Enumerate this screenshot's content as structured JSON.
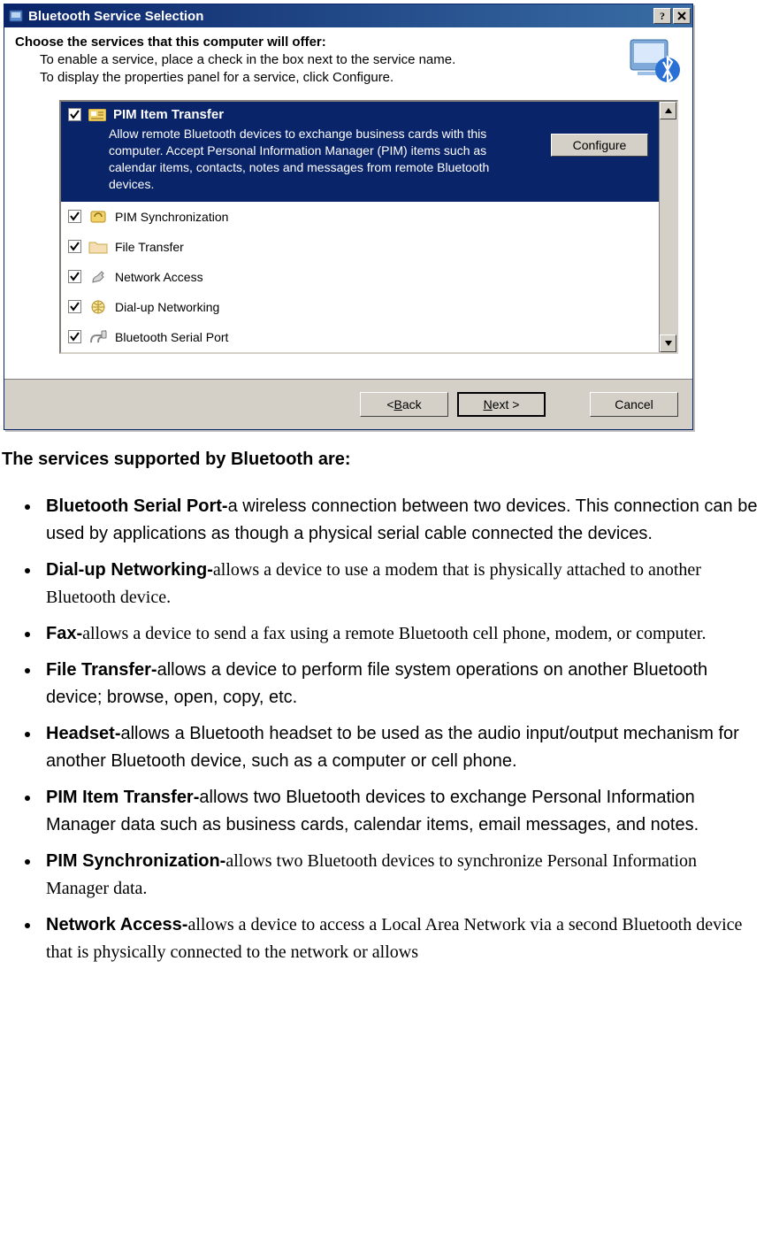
{
  "dialog": {
    "title": "Bluetooth Service Selection",
    "heading": "Choose the services that this computer will offer:",
    "sub1": "To enable a service, place a check in the box next to the service name.",
    "sub2": "To display the properties panel for a service, click Configure.",
    "configure": "Configure",
    "selected": {
      "name": "PIM Item Transfer",
      "desc": "Allow remote Bluetooth devices to exchange business cards with this computer. Accept Personal Information Manager (PIM) items such as calendar items, contacts, notes and messages from remote Bluetooth devices.",
      "checked": true
    },
    "services": [
      {
        "name": "PIM Synchronization",
        "checked": true,
        "icon": "sync"
      },
      {
        "name": "File Transfer",
        "checked": true,
        "icon": "folder"
      },
      {
        "name": "Network Access",
        "checked": true,
        "icon": "plug"
      },
      {
        "name": "Dial-up Networking",
        "checked": true,
        "icon": "globe"
      },
      {
        "name": "Bluetooth Serial Port",
        "checked": true,
        "icon": "serial"
      }
    ],
    "buttons": {
      "back_prefix": "< ",
      "back_letter": "B",
      "back_rest": "ack",
      "next_letter": "N",
      "next_rest": "ext >",
      "cancel": "Cancel"
    }
  },
  "doc": {
    "lead": "The services supported by Bluetooth are:",
    "items": [
      {
        "term": "Bluetooth Serial Port-",
        "body": "a wireless connection between two devices. This connection can be used by applications as though a physical serial cable connected the devices.",
        "alt": false
      },
      {
        "term": "Dial-up Networking-",
        "body": "allows a device to use a modem that is physically attached to another Bluetooth device.",
        "alt": true
      },
      {
        "term": "Fax-",
        "body": "allows a device to send a fax using a remote Bluetooth cell phone, modem, or computer.",
        "alt": true
      },
      {
        "term": "File Transfer-",
        "body": "allows a device to perform file system operations on another Bluetooth device; browse, open, copy, etc.",
        "alt": false
      },
      {
        "term": "Headset-",
        "body": "allows a Bluetooth headset to be used as the audio input/output mechanism for another Bluetooth device, such as a computer or cell phone.",
        "alt": false
      },
      {
        "term": "PIM Item Transfer-",
        "body": "allows two Bluetooth devices to exchange Personal Information Manager data such as business cards, calendar items, email messages, and notes.",
        "alt": false
      },
      {
        "term": "PIM Synchronization-",
        "body": "allows two Bluetooth devices to synchronize Personal Information Manager data.",
        "alt": true
      },
      {
        "term": "Network Access-",
        "body": "allows a device to access a Local Area Network via a second Bluetooth device that is physically connected to the network or allows",
        "alt": true
      }
    ]
  }
}
